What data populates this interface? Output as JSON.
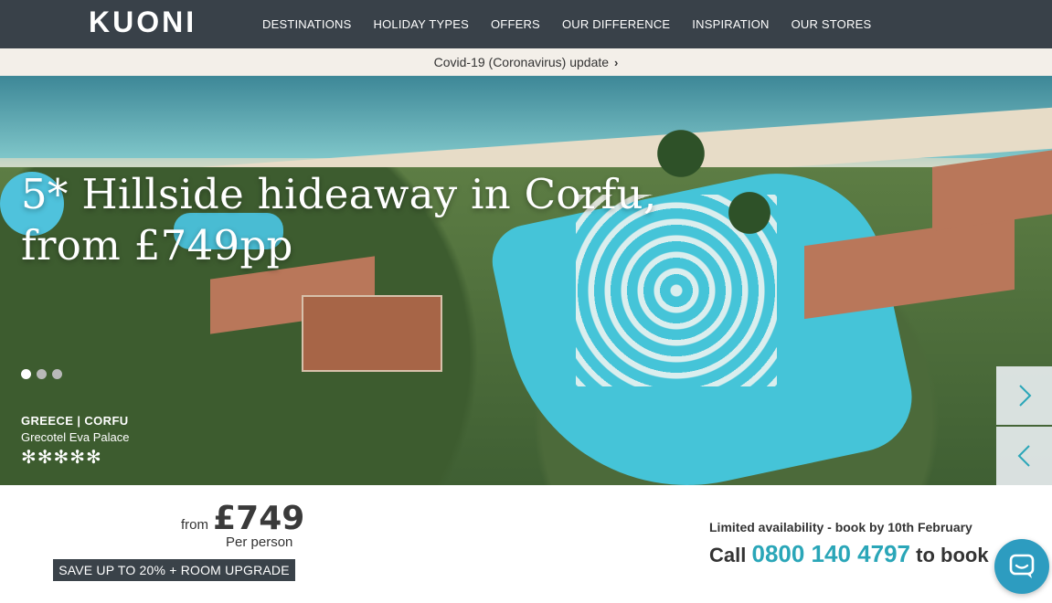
{
  "header": {
    "logo_text": "KUONI",
    "nav": [
      "DESTINATIONS",
      "HOLIDAY TYPES",
      "OFFERS",
      "OUR DIFFERENCE",
      "INSPIRATION",
      "OUR STORES"
    ]
  },
  "banner": {
    "text": "Covid-19 (Coronavirus) update",
    "icon": "chevron-right-icon"
  },
  "hero": {
    "headline_line1": "5* Hillside hideaway in Corfu,",
    "headline_line2": "from £749pp",
    "slides_count": 3,
    "active_slide": 1,
    "location": "GREECE | CORFU",
    "hotel_name": "Grecotel Eva Palace",
    "stars": "✻✻✻✻✻",
    "next_icon": "chevron-right-icon",
    "prev_icon": "chevron-left-icon"
  },
  "offer": {
    "from_label": "from",
    "price": "£749",
    "per_person": "Per person",
    "save_label": "SAVE UP TO 20% + ROOM UPGRADE",
    "availability": "Limited availability - book by 10th February",
    "call_prefix": "Call",
    "phone": "0800 140 4797",
    "call_suffix": "to book"
  },
  "chat": {
    "icon": "chat-bubble-icon"
  },
  "colors": {
    "nav_bg": "#394149",
    "banner_bg": "#f3efe9",
    "accent": "#2aa6b8",
    "chat_bg": "#2d9cc0"
  }
}
